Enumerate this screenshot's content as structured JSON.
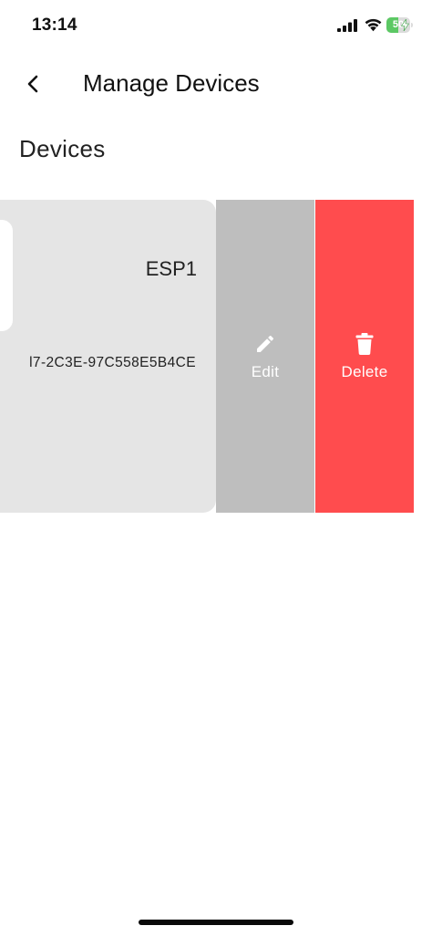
{
  "status_bar": {
    "time": "13:14",
    "battery_level": "50",
    "battery_fraction": 0.5,
    "icons": [
      "signal-icon",
      "wifi-icon",
      "battery-icon",
      "charging-bolt-icon"
    ]
  },
  "header": {
    "back_icon": "chevron-left-icon",
    "title": "Manage Devices"
  },
  "section": {
    "title": "Devices"
  },
  "devices": [
    {
      "name": "ESP1",
      "id_visible": "l7-2C3E-97C558E5B4CE"
    }
  ],
  "actions": {
    "edit_label": "Edit",
    "edit_icon": "pencil-icon",
    "delete_label": "Delete",
    "delete_icon": "trash-icon"
  },
  "colors": {
    "card_background": "#e5e5e5",
    "edit_background": "#bebebe",
    "delete_background": "#ff4c4e",
    "battery_green": "#5cc864"
  }
}
